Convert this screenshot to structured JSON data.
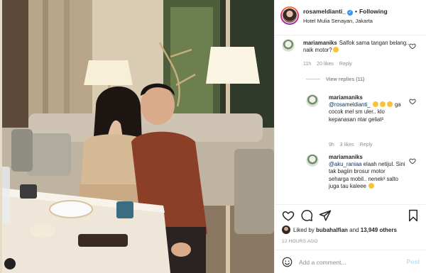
{
  "header": {
    "username": "rosameldianti_",
    "verified_icon": "verified-badge-icon",
    "separator": "•",
    "follow_label": "Following",
    "location": "Hotel Mulia Senayan, Jakarta",
    "more_icon": "more-options-icon"
  },
  "comments": [
    {
      "username": "mariamaniks",
      "text": "Salfok sama tangan belang.. naik motor?",
      "time": "11h",
      "likes": "20 likes",
      "reply_label": "Reply"
    }
  ],
  "view_replies": "View replies (11)",
  "replies": [
    {
      "username": "mariamaniks",
      "mention": "@rosameldianti_",
      "text": "ga cocok mel sm uler.. klo kepanasan ntar geliat²",
      "time": "9h",
      "likes": "3 likes",
      "reply_label": "Reply"
    },
    {
      "username": "mariamaniks",
      "mention": "@aku_raniaa",
      "text": "elaah netijul. Sini tak bagiin brosur motor seharga mobil.. nenek² salto juga tau kaleee",
      "time": "",
      "likes": "",
      "reply_label": ""
    }
  ],
  "actions": {
    "like_icon": "heart-icon",
    "comment_icon": "comment-icon",
    "share_icon": "share-icon",
    "save_icon": "bookmark-icon"
  },
  "likes": {
    "prefix": "Liked by",
    "user": "bubahalfian",
    "conjunction": "and",
    "count": "13,949 others"
  },
  "timestamp": "12 HOURS AGO",
  "composer": {
    "placeholder": "Add a comment...",
    "post_label": "Post",
    "emoji_icon": "smiley-icon"
  },
  "colors": {
    "link": "#00376b",
    "meta": "#8e8e8e",
    "post_disabled": "#b2dffc",
    "verified": "#3897f0"
  }
}
